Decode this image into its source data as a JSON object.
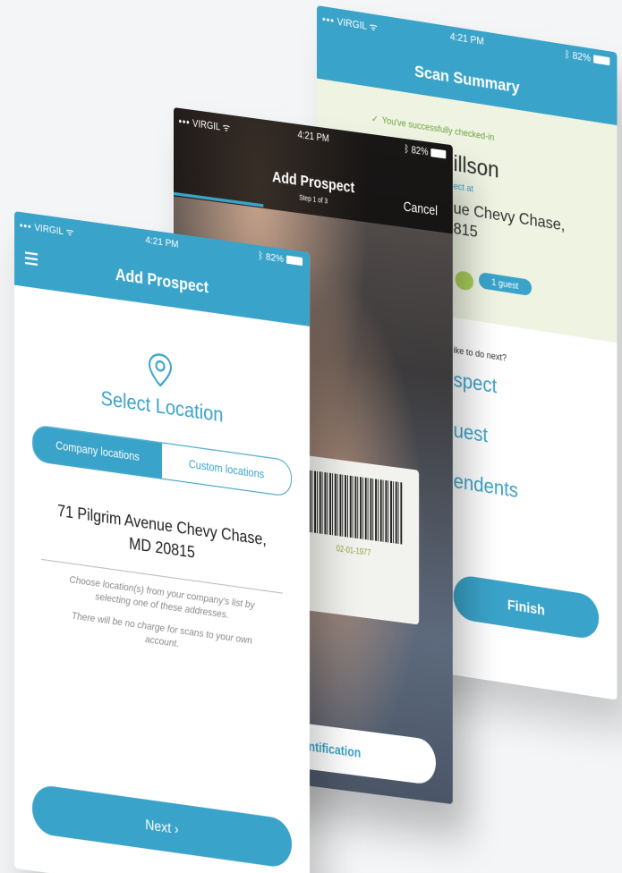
{
  "summary_screen": {
    "status": {
      "carrier": "VIRGIL",
      "time": "4:21 PM",
      "battery": "82%"
    },
    "title": "Scan Summary",
    "success_message": "You've successfully checked-in",
    "name_fragment": "illson",
    "checkin_at_fragment": "ect at",
    "address_fragment_1": "ue Chevy Chase,",
    "address_fragment_2": "815",
    "guest_badge": "1 guest",
    "next_question_fragment": "ike to do next?",
    "options": [
      "spect",
      "uest",
      "endents"
    ],
    "finish_label": "Finish"
  },
  "camera_screen": {
    "status": {
      "carrier": "VIRGIL",
      "time": "4:21 PM",
      "battery": "82%"
    },
    "title": "Add Prospect",
    "step": "Step 1 of 3",
    "cancel_label": "Cancel",
    "card_date": "02-01-1977",
    "scan_button_fragment": "d Identification"
  },
  "front_screen": {
    "status": {
      "carrier": "VIRGIL",
      "time": "4:21 PM",
      "battery": "82%"
    },
    "title": "Add Prospect",
    "section_title": "Select Location",
    "tabs": {
      "company": "Company locations",
      "custom": "Custom locations"
    },
    "address_line1": "71 Pilgrim Avenue Chevy Chase,",
    "address_line2": "MD 20815",
    "help_text_1": "Choose location(s) from your company's list by selecting one of these addresses.",
    "help_text_2": "There will be no charge for scans to your own account.",
    "next_label": "Next ›"
  },
  "colors": {
    "accent": "#3aa3c9",
    "success": "#6aa33c",
    "band": "#eef3e2"
  }
}
